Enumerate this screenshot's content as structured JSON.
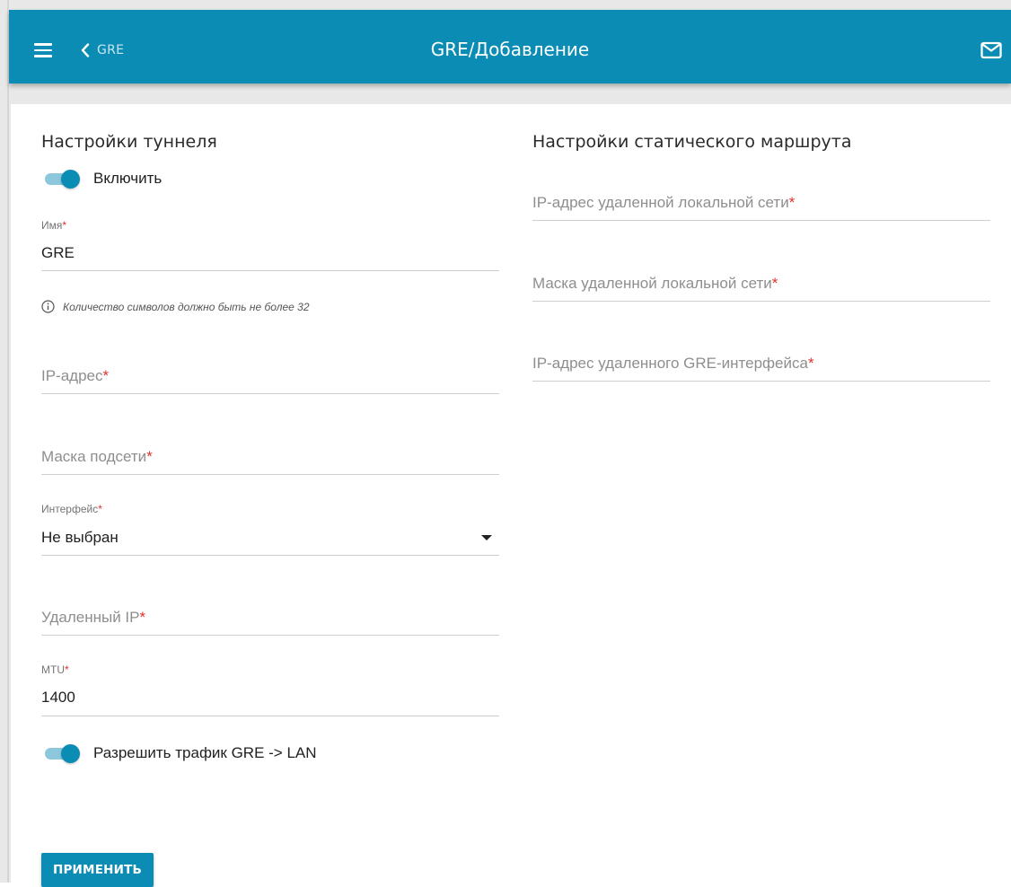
{
  "header": {
    "menu_icon": "hamburger-menu-icon",
    "back_icon": "chevron-left-icon",
    "back_label": "GRE",
    "title": "GRE/Добавление",
    "mail_icon": "envelope-icon",
    "background_color": "#0a8cb4"
  },
  "tunnel": {
    "title": "Настройки туннеля",
    "enable": {
      "label": "Включить",
      "on": true
    },
    "name": {
      "label": "Имя",
      "required_mark": "*",
      "value": "GRE"
    },
    "name_hint": {
      "icon": "info-circle-icon",
      "text": "Количество символов должно быть не более 32"
    },
    "ip_address": {
      "placeholder": "IP-адрес",
      "required_mark": "*"
    },
    "subnet_mask": {
      "placeholder": "Маска подсети",
      "required_mark": "*"
    },
    "interface": {
      "label": "Интерфейс",
      "required_mark": "*",
      "value": "Не выбран"
    },
    "remote_ip": {
      "placeholder": "Удаленный IP",
      "required_mark": "*"
    },
    "mtu": {
      "label": "MTU",
      "required_mark": "*",
      "value": "1400"
    },
    "allow_traffic": {
      "label": "Разрешить трафик GRE -> LAN",
      "on": true
    }
  },
  "static_route": {
    "title": "Настройки статического маршрута",
    "remote_lan_ip": {
      "placeholder": "IP-адрес удаленной локальной сети",
      "required_mark": "*"
    },
    "remote_lan_mask": {
      "placeholder": "Маска удаленной локальной сети",
      "required_mark": "*"
    },
    "remote_gre_ip": {
      "placeholder": "IP-адрес удаленного GRE-интерфейса",
      "required_mark": "*"
    }
  },
  "apply_button": "ПРИМЕНИТЬ",
  "colors": {
    "accent": "#0a8cb4",
    "required": "#e0312b"
  }
}
